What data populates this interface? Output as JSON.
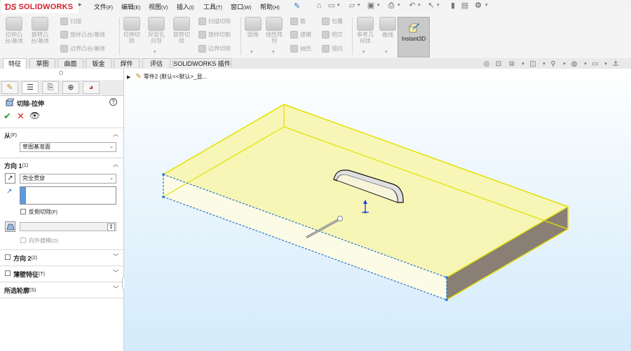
{
  "app": {
    "logo_ds": "ƊS",
    "logo_name": "SOLIDWORKS"
  },
  "menu": [
    {
      "label": "文件",
      "key": "(F)"
    },
    {
      "label": "编辑",
      "key": "(E)"
    },
    {
      "label": "视图",
      "key": "(V)"
    },
    {
      "label": "插入",
      "key": "(I)"
    },
    {
      "label": "工具",
      "key": "(T)"
    },
    {
      "label": "窗口",
      "key": "(W)"
    },
    {
      "label": "帮助",
      "key": "(H)"
    }
  ],
  "commands": {
    "extrude_boss": "拉伸凸\n台/基体",
    "revolve_boss": "旋转凸\n台/基体",
    "sweep": "扫描",
    "loft_boss": "放样凸台/基体",
    "boundary_boss": "边界凸台/基体",
    "extrude_cut": "拉伸切\n除",
    "hole_wizard": "异型孔\n向导",
    "revolve_cut": "旋转切\n除",
    "swept_cut": "扫描切除",
    "lofted_cut": "放样切割",
    "boundary_cut": "边界切除",
    "fillet": "圆角",
    "linear_pattern": "线性阵\n列",
    "rib": "筋",
    "draft": "拔模",
    "shell": "抽壳",
    "wrap": "包覆",
    "intersect": "相交",
    "mirror": "镜向",
    "ref_geometry": "参考几\n何体",
    "curves": "曲线",
    "instant3d": "Instant3D"
  },
  "tabs": [
    "特征",
    "草图",
    "曲面",
    "钣金",
    "焊件",
    "评估",
    "SOLIDWORKS 插件"
  ],
  "tree": {
    "part_label": "零件2  (默认<<默认>_显..."
  },
  "property_manager": {
    "title": "切除-拉伸",
    "from": {
      "header": "从",
      "key": "(F)",
      "value": "草图基准面"
    },
    "direction1": {
      "header": "方向 1",
      "key": "(1)",
      "end_condition": "完全贯穿",
      "flip_label": "反侧切除",
      "flip_key": "(F)",
      "draft_outward": "向外拔模",
      "draft_key": "(O)"
    },
    "direction2": {
      "label": "方向 2",
      "key": "(2)"
    },
    "thin_feature": {
      "label": "薄壁特征",
      "key": "(T)"
    },
    "selected_contours": {
      "label": "所选轮廓",
      "key": "(S)"
    }
  },
  "colors": {
    "accent_blue": "#2a77c8",
    "face_yellow": "#f7f5b0",
    "edge_yellow": "#e5e000",
    "side_brown": "#8a7f75",
    "logo_red": "#d6212a"
  }
}
